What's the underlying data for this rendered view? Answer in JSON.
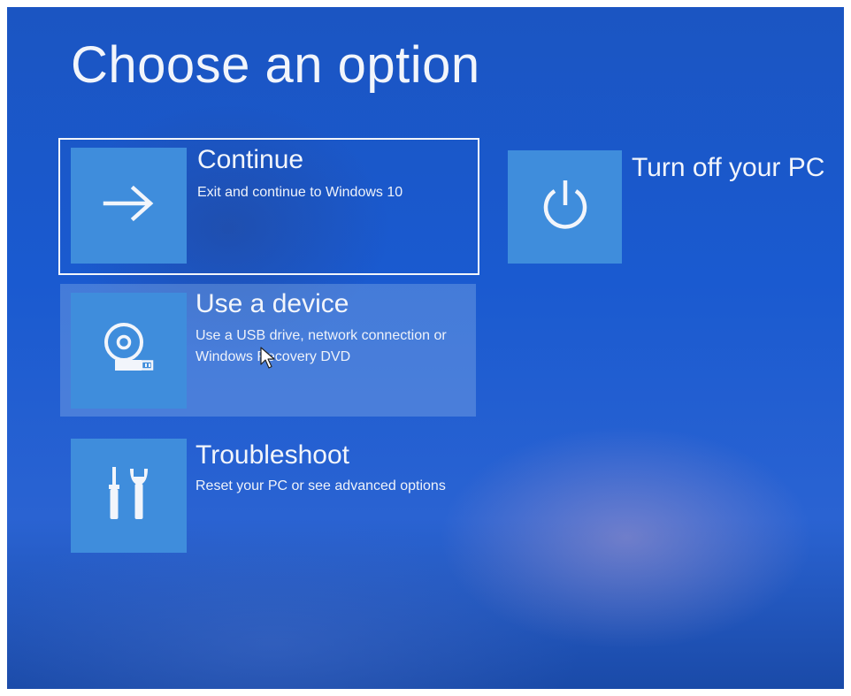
{
  "screen": {
    "title": "Choose an option"
  },
  "options": [
    {
      "id": "continue",
      "title": "Continue",
      "description_lines": [
        "Exit and continue to Windows 10"
      ],
      "icon": "arrow-right-icon"
    },
    {
      "id": "use-device",
      "title": "Use a device",
      "description_lines": [
        "Use a USB drive, network connection or",
        "Windows Recovery DVD"
      ],
      "icon": "disc-usb-icon"
    },
    {
      "id": "troubleshoot",
      "title": "Troubleshoot",
      "description_lines": [
        "Reset your PC or see advanced options"
      ],
      "icon": "tools-icon"
    },
    {
      "id": "turn-off",
      "title": "Turn off your PC",
      "description_lines": [],
      "icon": "power-icon"
    }
  ],
  "colors": {
    "background": "#1a5ad0",
    "tile": "#3f8ddc",
    "text": "#f2f5fb"
  }
}
